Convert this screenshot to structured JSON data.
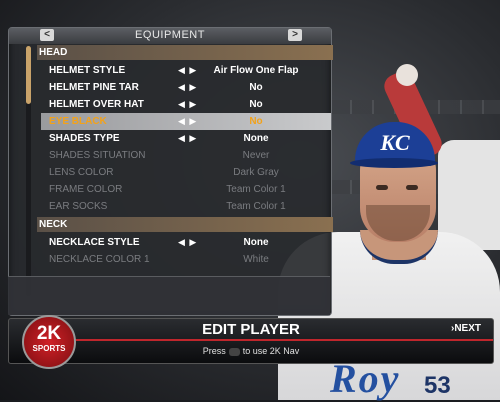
{
  "panel": {
    "title": "EQUIPMENT",
    "nav_left": "<",
    "nav_right": ">"
  },
  "sections": [
    {
      "label": "HEAD",
      "rows": [
        {
          "label": "HELMET STYLE",
          "value": "Air Flow One Flap",
          "arrows": "◀ ▶",
          "state": "normal"
        },
        {
          "label": "HELMET PINE TAR",
          "value": "No",
          "arrows": "◀ ▶",
          "state": "normal"
        },
        {
          "label": "HELMET OVER HAT",
          "value": "No",
          "arrows": "◀ ▶",
          "state": "normal"
        },
        {
          "label": "EYE BLACK",
          "value": "No",
          "arrows": "◀ ▶",
          "state": "selected"
        },
        {
          "label": "SHADES TYPE",
          "value": "None",
          "arrows": "◀ ▶",
          "state": "normal"
        },
        {
          "label": "SHADES SITUATION",
          "value": "Never",
          "arrows": "",
          "state": "disabled"
        },
        {
          "label": "LENS COLOR",
          "value": "Dark Gray",
          "arrows": "",
          "state": "disabled"
        },
        {
          "label": "FRAME COLOR",
          "value": "Team Color 1",
          "arrows": "",
          "state": "disabled"
        },
        {
          "label": "EAR SOCKS",
          "value": "Team Color 1",
          "arrows": "",
          "state": "disabled"
        }
      ]
    },
    {
      "label": "NECK",
      "rows": [
        {
          "label": "NECKLACE STYLE",
          "value": "None",
          "arrows": "◀ ▶",
          "state": "normal"
        },
        {
          "label": "NECKLACE COLOR 1",
          "value": "White",
          "arrows": "",
          "state": "disabled"
        }
      ]
    }
  ],
  "bottom_bar": {
    "title": "EDIT PLAYER",
    "hint_prefix": "Press",
    "hint_suffix": "to use 2K Nav",
    "next_label": "›NEXT"
  },
  "logo": {
    "top": "2K",
    "bottom": "SPORTS"
  },
  "player": {
    "cap_logo": "KC",
    "jersey_script": "Roy",
    "jersey_number": "53"
  },
  "colors": {
    "selected_text": "#f2a21b",
    "accent_red": "#c0262c",
    "cap_blue": "#1c3f96"
  }
}
